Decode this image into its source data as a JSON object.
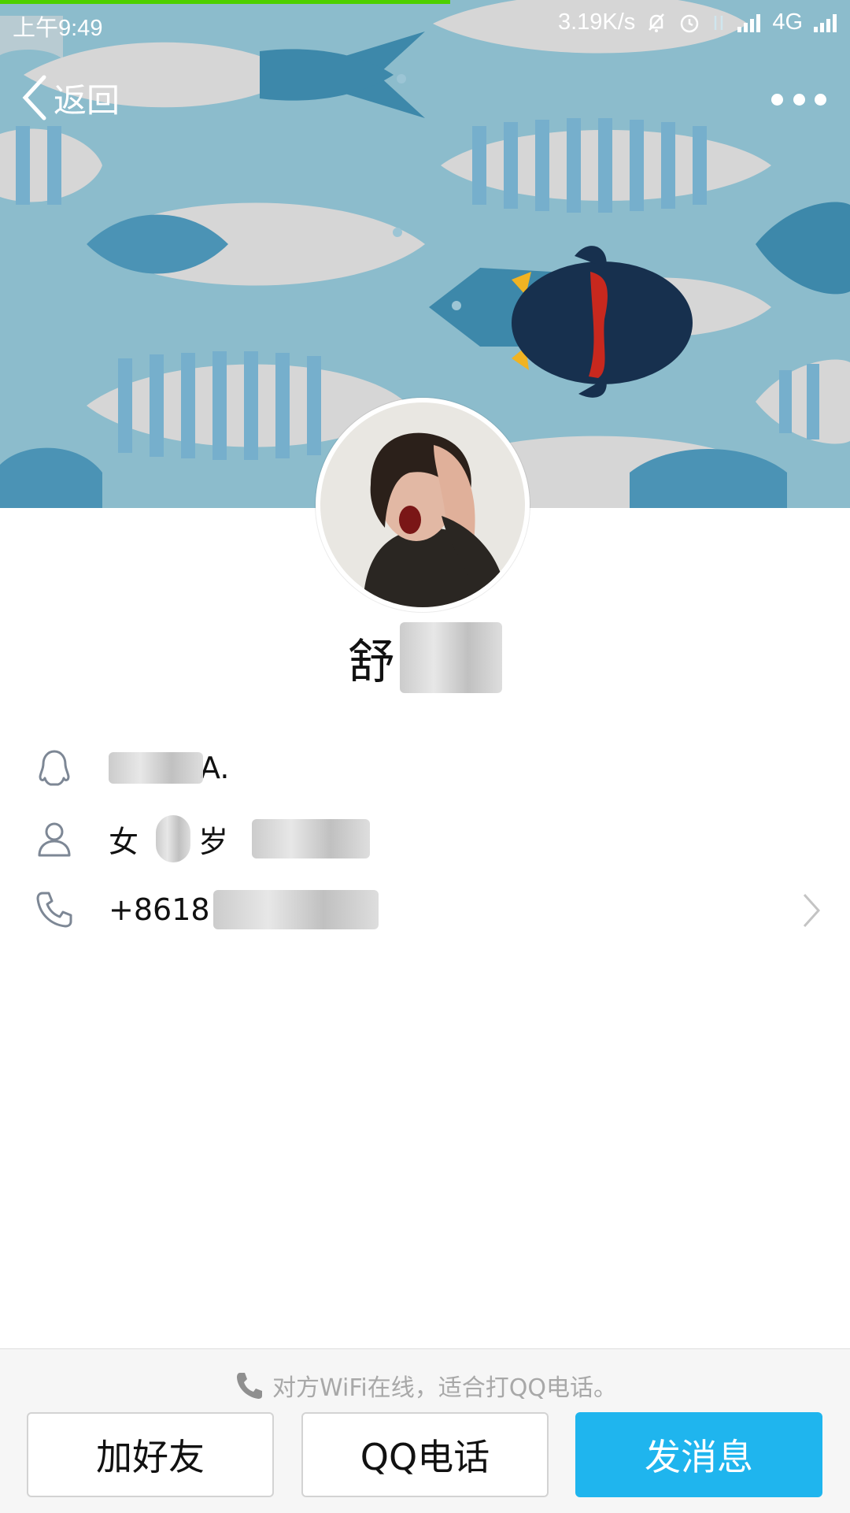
{
  "status_bar": {
    "time": "上午9:49",
    "net_speed": "3.19K/s",
    "network": "4G",
    "icons": [
      "mute-bell-icon",
      "alarm-icon",
      "data-arrows-icon",
      "signal-icon",
      "signal-icon"
    ]
  },
  "nav": {
    "back_label": "返回",
    "more_icon": "more-dots-icon"
  },
  "profile": {
    "name_visible": "舒",
    "qq_id_visible": "A.",
    "gender": "女",
    "age_unit": "岁",
    "phone_visible": "+8618"
  },
  "bottom": {
    "tip": "对方WiFi在线，适合打QQ电话。",
    "add_friend": "加好友",
    "qq_call": "QQ电话",
    "send_message": "发消息"
  },
  "colors": {
    "accent": "#1fb5ee",
    "progress": "#4cd000",
    "cover_bg": "#7fb6c8"
  }
}
